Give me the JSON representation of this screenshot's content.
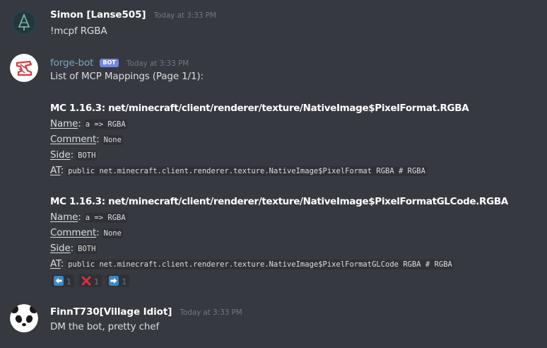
{
  "messages": [
    {
      "author": "Simon [Lanse505]",
      "timestamp": "Today at 3:33 PM",
      "text": "!mcpf RGBA"
    },
    {
      "author": "forge-bot",
      "badge": "BOT",
      "timestamp": "Today at 3:33 PM",
      "intro": "List of MCP Mappings (Page 1/1):",
      "mappings": [
        {
          "heading": "MC 1.16.3: net/minecraft/client/renderer/texture/NativeImage$PixelFormat.RGBA",
          "name_label": "Name",
          "name_value": "a => RGBA",
          "comment_label": "Comment",
          "comment_value": "None",
          "side_label": "Side",
          "side_value": "BOTH",
          "at_label": "AT",
          "at_value": "public net.minecraft.client.renderer.texture.NativeImage$PixelFormat RGBA # RGBA"
        },
        {
          "heading": "MC 1.16.3: net/minecraft/client/renderer/texture/NativeImage$PixelFormatGLCode.RGBA",
          "name_label": "Name",
          "name_value": "a => RGBA",
          "comment_label": "Comment",
          "comment_value": "None",
          "side_label": "Side",
          "side_value": "BOTH",
          "at_label": "AT",
          "at_value": "public net.minecraft.client.renderer.texture.NativeImage$PixelFormatGLCode RGBA # RGBA"
        }
      ],
      "reactions": [
        {
          "icon": "arrow-left-icon",
          "count": "1"
        },
        {
          "icon": "cross-mark-icon",
          "count": "1"
        },
        {
          "icon": "arrow-right-icon",
          "count": "1"
        }
      ]
    },
    {
      "author": "FinnT730[Village Idiot]",
      "timestamp": "Today at 3:33 PM",
      "text": "DM the bot, pretty chef"
    }
  ],
  "colors": {
    "background": "#36393f",
    "code_background": "#2f3136",
    "bot_name": "#7aa8c6",
    "bot_badge": "#7289da",
    "timestamp": "#72767d",
    "reaction_blue": "#3b88c3",
    "reaction_red": "#dd2e44"
  }
}
